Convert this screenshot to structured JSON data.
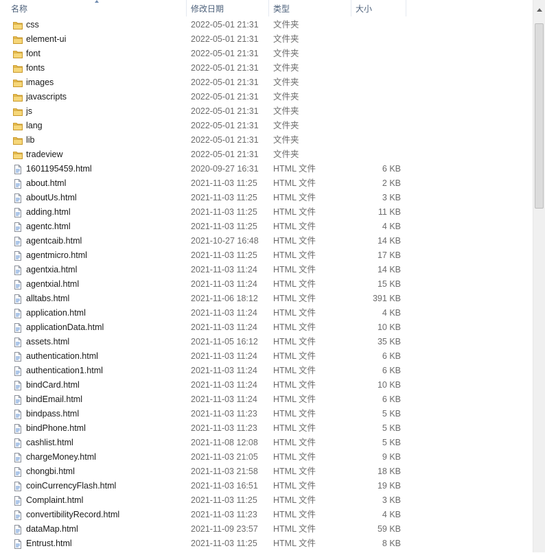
{
  "columns": {
    "name": "名称",
    "date": "修改日期",
    "type": "类型",
    "size": "大小"
  },
  "colors": {
    "folder": "#e8b73c",
    "header_text": "#4c607a"
  },
  "files": [
    {
      "name": "css",
      "date": "2022-05-01 21:31",
      "type": "文件夹",
      "size": "",
      "icon": "folder-icon"
    },
    {
      "name": "element-ui",
      "date": "2022-05-01 21:31",
      "type": "文件夹",
      "size": "",
      "icon": "folder-icon"
    },
    {
      "name": "font",
      "date": "2022-05-01 21:31",
      "type": "文件夹",
      "size": "",
      "icon": "folder-icon"
    },
    {
      "name": "fonts",
      "date": "2022-05-01 21:31",
      "type": "文件夹",
      "size": "",
      "icon": "folder-icon"
    },
    {
      "name": "images",
      "date": "2022-05-01 21:31",
      "type": "文件夹",
      "size": "",
      "icon": "folder-icon"
    },
    {
      "name": "javascripts",
      "date": "2022-05-01 21:31",
      "type": "文件夹",
      "size": "",
      "icon": "folder-icon"
    },
    {
      "name": "js",
      "date": "2022-05-01 21:31",
      "type": "文件夹",
      "size": "",
      "icon": "folder-icon"
    },
    {
      "name": "lang",
      "date": "2022-05-01 21:31",
      "type": "文件夹",
      "size": "",
      "icon": "folder-icon"
    },
    {
      "name": "lib",
      "date": "2022-05-01 21:31",
      "type": "文件夹",
      "size": "",
      "icon": "folder-icon"
    },
    {
      "name": "tradeview",
      "date": "2022-05-01 21:31",
      "type": "文件夹",
      "size": "",
      "icon": "folder-icon"
    },
    {
      "name": "1601195459.html",
      "date": "2020-09-27 16:31",
      "type": "HTML 文件",
      "size": "6 KB",
      "icon": "html-file-icon"
    },
    {
      "name": "about.html",
      "date": "2021-11-03 11:25",
      "type": "HTML 文件",
      "size": "2 KB",
      "icon": "html-file-icon"
    },
    {
      "name": "aboutUs.html",
      "date": "2021-11-03 11:25",
      "type": "HTML 文件",
      "size": "3 KB",
      "icon": "html-file-icon"
    },
    {
      "name": "adding.html",
      "date": "2021-11-03 11:25",
      "type": "HTML 文件",
      "size": "11 KB",
      "icon": "html-file-icon"
    },
    {
      "name": "agentc.html",
      "date": "2021-11-03 11:25",
      "type": "HTML 文件",
      "size": "4 KB",
      "icon": "html-file-icon"
    },
    {
      "name": "agentcaib.html",
      "date": "2021-10-27 16:48",
      "type": "HTML 文件",
      "size": "14 KB",
      "icon": "html-file-icon"
    },
    {
      "name": "agentmicro.html",
      "date": "2021-11-03 11:25",
      "type": "HTML 文件",
      "size": "17 KB",
      "icon": "html-file-icon"
    },
    {
      "name": "agentxia.html",
      "date": "2021-11-03 11:24",
      "type": "HTML 文件",
      "size": "14 KB",
      "icon": "html-file-icon"
    },
    {
      "name": "agentxial.html",
      "date": "2021-11-03 11:24",
      "type": "HTML 文件",
      "size": "15 KB",
      "icon": "html-file-icon"
    },
    {
      "name": "alltabs.html",
      "date": "2021-11-06 18:12",
      "type": "HTML 文件",
      "size": "391 KB",
      "icon": "html-file-icon"
    },
    {
      "name": "application.html",
      "date": "2021-11-03 11:24",
      "type": "HTML 文件",
      "size": "4 KB",
      "icon": "html-file-icon"
    },
    {
      "name": "applicationData.html",
      "date": "2021-11-03 11:24",
      "type": "HTML 文件",
      "size": "10 KB",
      "icon": "html-file-icon"
    },
    {
      "name": "assets.html",
      "date": "2021-11-05 16:12",
      "type": "HTML 文件",
      "size": "35 KB",
      "icon": "html-file-icon"
    },
    {
      "name": "authentication.html",
      "date": "2021-11-03 11:24",
      "type": "HTML 文件",
      "size": "6 KB",
      "icon": "html-file-icon"
    },
    {
      "name": "authentication1.html",
      "date": "2021-11-03 11:24",
      "type": "HTML 文件",
      "size": "6 KB",
      "icon": "html-file-icon"
    },
    {
      "name": "bindCard.html",
      "date": "2021-11-03 11:24",
      "type": "HTML 文件",
      "size": "10 KB",
      "icon": "html-file-icon"
    },
    {
      "name": "bindEmail.html",
      "date": "2021-11-03 11:24",
      "type": "HTML 文件",
      "size": "6 KB",
      "icon": "html-file-icon"
    },
    {
      "name": "bindpass.html",
      "date": "2021-11-03 11:23",
      "type": "HTML 文件",
      "size": "5 KB",
      "icon": "html-file-icon"
    },
    {
      "name": "bindPhone.html",
      "date": "2021-11-03 11:23",
      "type": "HTML 文件",
      "size": "5 KB",
      "icon": "html-file-icon"
    },
    {
      "name": "cashlist.html",
      "date": "2021-11-08 12:08",
      "type": "HTML 文件",
      "size": "5 KB",
      "icon": "html-file-icon"
    },
    {
      "name": "chargeMoney.html",
      "date": "2021-11-03 21:05",
      "type": "HTML 文件",
      "size": "9 KB",
      "icon": "html-file-icon"
    },
    {
      "name": "chongbi.html",
      "date": "2021-11-03 21:58",
      "type": "HTML 文件",
      "size": "18 KB",
      "icon": "html-file-icon"
    },
    {
      "name": "coinCurrencyFlash.html",
      "date": "2021-11-03 16:51",
      "type": "HTML 文件",
      "size": "19 KB",
      "icon": "html-file-icon"
    },
    {
      "name": "Complaint.html",
      "date": "2021-11-03 11:25",
      "type": "HTML 文件",
      "size": "3 KB",
      "icon": "html-file-icon"
    },
    {
      "name": "convertibilityRecord.html",
      "date": "2021-11-03 11:23",
      "type": "HTML 文件",
      "size": "4 KB",
      "icon": "html-file-icon"
    },
    {
      "name": "dataMap.html",
      "date": "2021-11-09 23:57",
      "type": "HTML 文件",
      "size": "59 KB",
      "icon": "html-file-icon"
    },
    {
      "name": "Entrust.html",
      "date": "2021-11-03 11:25",
      "type": "HTML 文件",
      "size": "8 KB",
      "icon": "html-file-icon"
    }
  ]
}
